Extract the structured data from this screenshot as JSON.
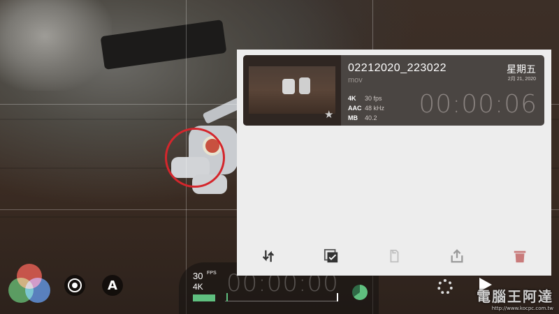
{
  "clip": {
    "name": "02212020_223022",
    "extension": "mov",
    "day": "星期五",
    "date": "2月 21, 2020",
    "specs": [
      {
        "key": "4K",
        "value": "30 fps"
      },
      {
        "key": "AAC",
        "value": "48 kHz"
      },
      {
        "key": "MB",
        "value": "40.2"
      }
    ],
    "duration": "00:00:06"
  },
  "toolbar": {
    "items": [
      {
        "icon": "transfer-icon",
        "color": "#333333"
      },
      {
        "icon": "select-all-icon",
        "color": "#333333"
      },
      {
        "icon": "clipboard-icon",
        "color": "#bfbfbf"
      },
      {
        "icon": "share-icon",
        "color": "#9a9a9a"
      },
      {
        "icon": "trash-icon",
        "color": "#c97b7b"
      }
    ]
  },
  "hud": {
    "fps": "30",
    "fps_unit": "FPS",
    "resolution": "4K",
    "timecode": "00:00:00",
    "storage_fraction": 0.65
  },
  "controls": {
    "auto_label": "A"
  },
  "watermark": {
    "text": "電腦王阿達",
    "url": "http://www.kocpc.com.tw"
  },
  "colors": {
    "focus_ring": "#d4262c",
    "accent_green": "#5fbf7f",
    "card_bg": "#4a4542",
    "panel_bg": "#ededed"
  }
}
